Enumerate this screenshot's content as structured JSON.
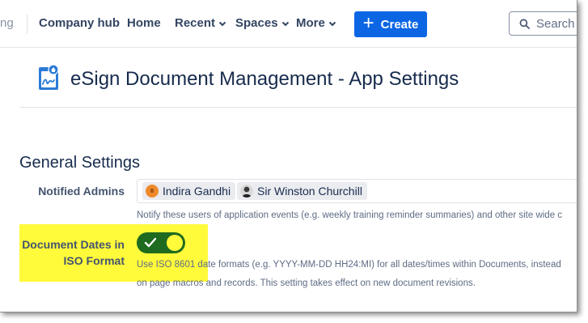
{
  "nav": {
    "cut_text": "ng",
    "items": [
      {
        "label": "Company hub"
      },
      {
        "label": "Home"
      },
      {
        "label": "Recent"
      },
      {
        "label": "Spaces"
      },
      {
        "label": "More"
      }
    ],
    "create_label": "Create",
    "search_placeholder": "Search"
  },
  "page": {
    "title": "eSign Document Management - App Settings"
  },
  "settings": {
    "section_title": "General Settings",
    "notified_admins": {
      "label": "Notified Admins",
      "users": [
        {
          "name": "Indira Gandhi",
          "initials": "II"
        },
        {
          "name": "Sir Winston Churchill"
        }
      ],
      "help": "Notify these users of application events (e.g. weekly training reminder summaries) and other site wide c"
    },
    "iso_dates": {
      "label_line1": "Document Dates in",
      "label_line2": "ISO Format",
      "enabled": true,
      "help_line1": "Use ISO 8601 date formats (e.g. YYYY-MM-DD HH24:MI) for all dates/times within Documents, instead",
      "help_line2": "on page macros and records. This setting takes effect on new document revisions."
    }
  },
  "colors": {
    "primary": "#0c66e4",
    "toggle_on": "#1f6b1f",
    "highlight": "#fffa3a"
  }
}
